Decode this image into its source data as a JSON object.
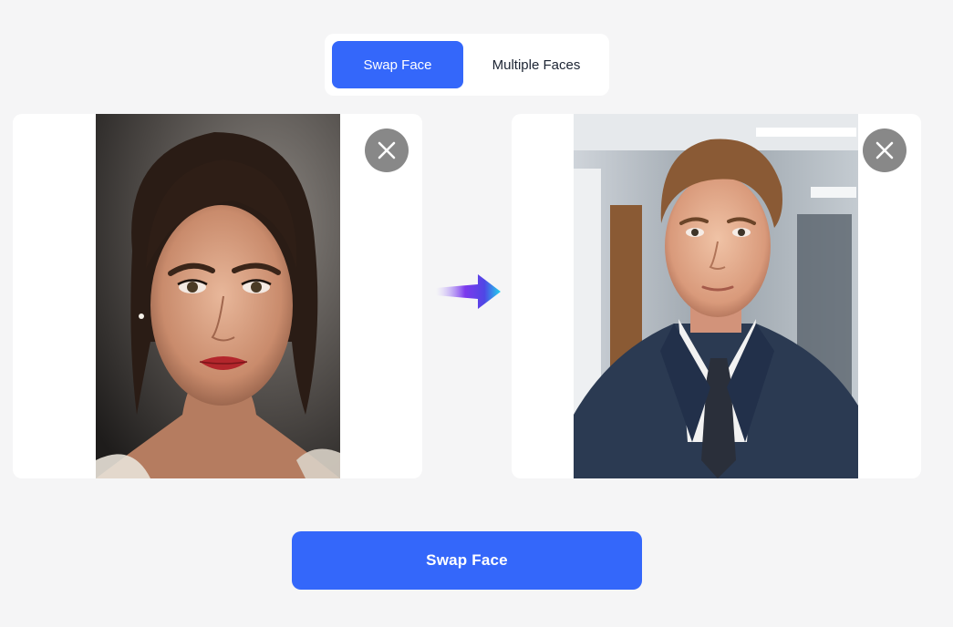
{
  "tabs": [
    {
      "label": "Swap Face",
      "active": true
    },
    {
      "label": "Multiple Faces",
      "active": false
    }
  ],
  "source_panel": {
    "image": "woman-portrait-photo",
    "close_icon": "close-icon"
  },
  "target_panel": {
    "image": "young-man-in-suit-photo",
    "close_icon": "close-icon"
  },
  "arrow_icon": "arrow-right-gradient-icon",
  "action": {
    "label": "Swap Face"
  },
  "colors": {
    "accent": "#3467fa",
    "background": "#f5f5f6",
    "panel": "#ffffff",
    "close_button": "#6e6e6e",
    "arrow_start": "#a78bfa",
    "arrow_mid": "#6d28d9",
    "arrow_end": "#22d3ee"
  }
}
